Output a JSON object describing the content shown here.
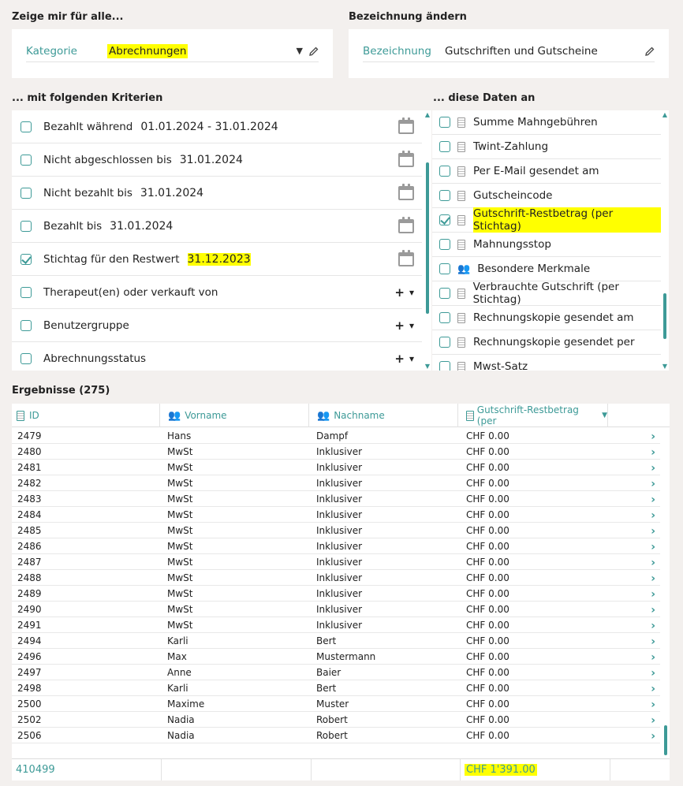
{
  "show_for": {
    "heading": "Zeige mir für alle...",
    "field_label": "Kategorie",
    "field_value": "Abrechnungen"
  },
  "rename": {
    "heading": "Bezeichnung ändern",
    "field_label": "Bezeichnung",
    "field_value": "Gutschriften und Gutscheine"
  },
  "criteria": {
    "heading": "... mit folgenden Kriterien",
    "items": [
      {
        "label": "Bezahlt während",
        "value": "01.01.2024 - 31.01.2024",
        "checked": false,
        "control": "calendar"
      },
      {
        "label": "Nicht abgeschlossen bis",
        "value": "31.01.2024",
        "checked": false,
        "control": "calendar"
      },
      {
        "label": "Nicht bezahlt bis",
        "value": "31.01.2024",
        "checked": false,
        "control": "calendar"
      },
      {
        "label": "Bezahlt bis",
        "value": "31.01.2024",
        "checked": false,
        "control": "calendar"
      },
      {
        "label": "Stichtag für den Restwert",
        "value": "31.12.2023",
        "checked": true,
        "control": "calendar"
      },
      {
        "label": "Therapeut(en) oder verkauft von",
        "value": "",
        "checked": false,
        "control": "plus-dropdown"
      },
      {
        "label": "Benutzergruppe",
        "value": "",
        "checked": false,
        "control": "plus-dropdown"
      },
      {
        "label": "Abrechnungsstatus",
        "value": "",
        "checked": false,
        "control": "plus-dropdown"
      }
    ]
  },
  "data_fields": {
    "heading": "... diese Daten an",
    "items": [
      {
        "label": "Summe Mahngebühren",
        "checked": false,
        "icon": "calculator-icon"
      },
      {
        "label": "Twint-Zahlung",
        "checked": false,
        "icon": "calculator-icon"
      },
      {
        "label": "Per E-Mail gesendet am",
        "checked": false,
        "icon": "calculator-icon"
      },
      {
        "label": "Gutscheincode",
        "checked": false,
        "icon": "calculator-icon"
      },
      {
        "label": "Gutschrift-Restbetrag (per Stichtag)",
        "checked": true,
        "icon": "calculator-icon"
      },
      {
        "label": "Mahnungsstop",
        "checked": false,
        "icon": "calculator-icon"
      },
      {
        "label": "Besondere Merkmale",
        "checked": false,
        "icon": "people-icon"
      },
      {
        "label": "Verbrauchte Gutschrift (per Stichtag)",
        "checked": false,
        "icon": "calculator-icon"
      },
      {
        "label": "Rechnungskopie gesendet am",
        "checked": false,
        "icon": "calculator-icon"
      },
      {
        "label": "Rechnungskopie gesendet per",
        "checked": false,
        "icon": "calculator-icon"
      },
      {
        "label": "Mwst-Satz",
        "checked": false,
        "icon": "calculator-icon"
      }
    ]
  },
  "results": {
    "heading": "Ergebnisse (275)",
    "columns": [
      "ID",
      "Vorname",
      "Nachname",
      "Gutschrift-Restbetrag (per"
    ],
    "rows": [
      [
        "2479",
        "Hans",
        "Dampf",
        "CHF 0.00"
      ],
      [
        "2480",
        "MwSt",
        "Inklusiver",
        "CHF 0.00"
      ],
      [
        "2481",
        "MwSt",
        "Inklusiver",
        "CHF 0.00"
      ],
      [
        "2482",
        "MwSt",
        "Inklusiver",
        "CHF 0.00"
      ],
      [
        "2483",
        "MwSt",
        "Inklusiver",
        "CHF 0.00"
      ],
      [
        "2484",
        "MwSt",
        "Inklusiver",
        "CHF 0.00"
      ],
      [
        "2485",
        "MwSt",
        "Inklusiver",
        "CHF 0.00"
      ],
      [
        "2486",
        "MwSt",
        "Inklusiver",
        "CHF 0.00"
      ],
      [
        "2487",
        "MwSt",
        "Inklusiver",
        "CHF 0.00"
      ],
      [
        "2488",
        "MwSt",
        "Inklusiver",
        "CHF 0.00"
      ],
      [
        "2489",
        "MwSt",
        "Inklusiver",
        "CHF 0.00"
      ],
      [
        "2490",
        "MwSt",
        "Inklusiver",
        "CHF 0.00"
      ],
      [
        "2491",
        "MwSt",
        "Inklusiver",
        "CHF 0.00"
      ],
      [
        "2494",
        "Karli",
        "Bert",
        "CHF 0.00"
      ],
      [
        "2496",
        "Max",
        "Mustermann",
        "CHF 0.00"
      ],
      [
        "2497",
        "Anne",
        "Baier",
        "CHF 0.00"
      ],
      [
        "2498",
        "Karli",
        "Bert",
        "CHF 0.00"
      ],
      [
        "2500",
        "Maxime",
        "Muster",
        "CHF 0.00"
      ],
      [
        "2502",
        "Nadia",
        "Robert",
        "CHF 0.00"
      ],
      [
        "2506",
        "Nadia",
        "Robert",
        "CHF 0.00"
      ]
    ],
    "footer": {
      "id_total": "410499",
      "amount_total": "CHF 1'391.00"
    }
  },
  "colors": {
    "accent": "#3d9a97",
    "highlight": "#ffff00",
    "background": "#f3f0ee"
  }
}
